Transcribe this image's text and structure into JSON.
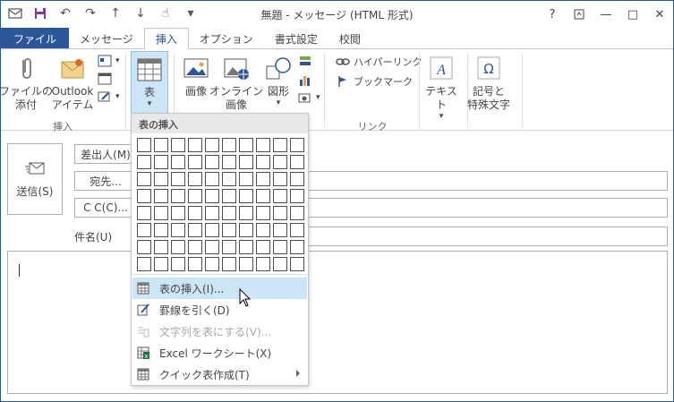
{
  "window": {
    "title": "無題 - メッセージ (HTML 形式)",
    "help": "?",
    "minimize": "—",
    "maximize": "□",
    "close": "✕"
  },
  "tabs": [
    {
      "label": "ファイル"
    },
    {
      "label": "メッセージ"
    },
    {
      "label": "挿入"
    },
    {
      "label": "オプション"
    },
    {
      "label": "書式設定"
    },
    {
      "label": "校閲"
    }
  ],
  "ribbon": {
    "attach_file": "ファイルの\n添付",
    "outlook_item": "Outlook\nアイテム",
    "include_group": "挿入",
    "table": "表",
    "picture": "画像",
    "online_picture": "オンライン\n画像",
    "shapes": "図形",
    "hyperlink": "ハイパーリンク",
    "bookmark": "ブックマーク",
    "links_group": "リンク",
    "text": "テキスト",
    "symbols": "記号と\n特殊文字"
  },
  "message": {
    "send": "送信(S)",
    "from": "差出人(M)",
    "to": "宛先...",
    "cc": "C C(C)...",
    "subject": "件名(U)"
  },
  "dropdown": {
    "header": "表の挿入",
    "rows": 8,
    "cols": 10,
    "items": [
      {
        "label": "表の挿入(I)...",
        "icon": "table-icon",
        "state": "hover"
      },
      {
        "label": "罫線を引く(D)",
        "icon": "draw-table-icon",
        "state": "normal"
      },
      {
        "label": "文字列を表にする(V)...",
        "icon": "convert-text-icon",
        "state": "disabled"
      },
      {
        "label": "Excel ワークシート(X)",
        "icon": "excel-icon",
        "state": "normal"
      },
      {
        "label": "クイック表作成(T)",
        "icon": "quick-table-icon",
        "state": "submenu"
      }
    ]
  },
  "colors": {
    "accent": "#2b579a",
    "hover": "#cde6f7",
    "excel": "#217346"
  }
}
